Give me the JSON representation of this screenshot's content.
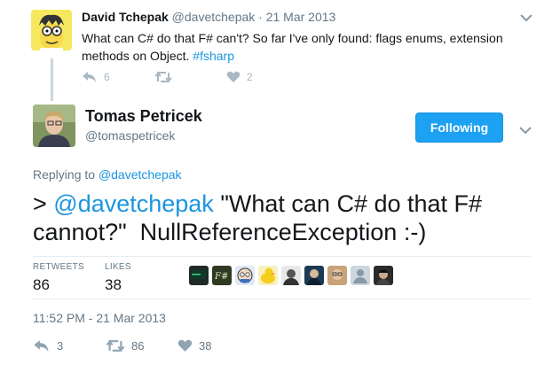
{
  "parent_tweet": {
    "name": "David Tchepak",
    "handle_date": "@davetchepak · 21 Mar 2013",
    "text": "What can C# do that F# can't? So far I've only found: flags enums, extension methods on Object.",
    "hashtag": "#fsharp",
    "reply_count": "6",
    "retweet_count": "",
    "like_count": "2",
    "icons": [
      "reply-icon",
      "retweet-icon",
      "heart-icon",
      "chevron-down-icon"
    ]
  },
  "main_tweet": {
    "name": "Tomas Petricek",
    "handle": "@tomaspetricek",
    "follow_label": "Following",
    "replying_prefix": "Replying to",
    "replying_handle": "@davetchepak",
    "text_prefix": "> ",
    "text_mention": "@davetchepak",
    "text_body": " \"What can C# do that F# cannot?\"  NullReferenceException :-)",
    "stats": {
      "retweets_label": "RETWEETS",
      "retweets_value": "86",
      "likes_label": "LIKES",
      "likes_value": "38"
    },
    "timestamp": "11:52 PM - 21 Mar 2013",
    "actions": {
      "reply_count": "3",
      "retweet_count": "86",
      "like_count": "38"
    }
  },
  "colors": {
    "link": "#1b95e0",
    "button": "#1da1f2",
    "muted": "#657786"
  }
}
